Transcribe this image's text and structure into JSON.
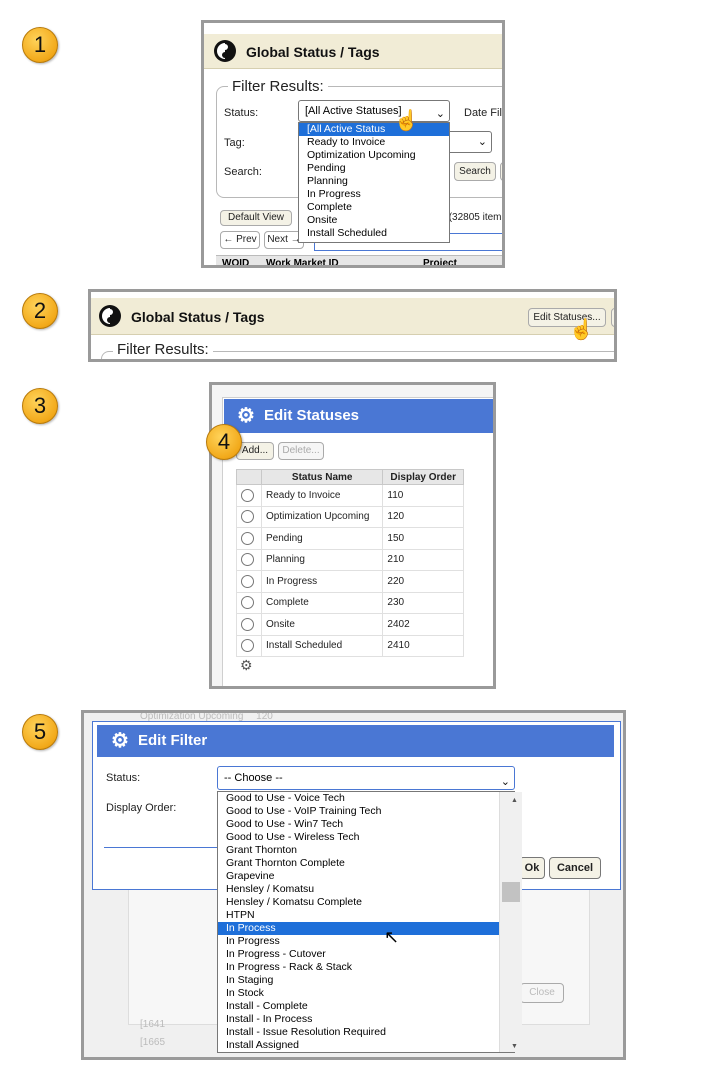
{
  "steps": [
    "1",
    "2",
    "3",
    "4",
    "5"
  ],
  "panel1": {
    "title": "Global Status / Tags",
    "filter_legend": "Filter Results:",
    "status_label": "Status:",
    "status_value": "[All Active Statuses]",
    "date_label": "Date Fil",
    "tag_label": "Tag:",
    "search_label": "Search:",
    "search_button": "Search",
    "default_view": "Default View",
    "items_text": "' (32805 item",
    "prev": "← Prev",
    "next": "Next →",
    "col_woid": "WOID",
    "col_workmarket": "Work Market ID",
    "col_project": "Project",
    "options": [
      "[All Active Status",
      "Ready to Invoice",
      "Optimization Upcoming",
      "Pending",
      "Planning",
      "In Progress",
      "Complete",
      "Onsite",
      "Install Scheduled"
    ]
  },
  "panel2": {
    "title": "Global Status / Tags",
    "edit_statuses": "Edit Statuses...",
    "filter_legend": "Filter Results:"
  },
  "panel3": {
    "title": "Edit Statuses",
    "add": "Add...",
    "delete": "Delete...",
    "col_name": "Status Name",
    "col_order": "Display Order",
    "rows": [
      {
        "name": "Ready to Invoice",
        "order": "110"
      },
      {
        "name": "Optimization Upcoming",
        "order": "120"
      },
      {
        "name": "Pending",
        "order": "150"
      },
      {
        "name": "Planning",
        "order": "210"
      },
      {
        "name": "In Progress",
        "order": "220"
      },
      {
        "name": "Complete",
        "order": "230"
      },
      {
        "name": "Onsite",
        "order": "2402"
      },
      {
        "name": "Install Scheduled",
        "order": "2410"
      }
    ]
  },
  "panel5": {
    "bg_row_name": "Optimization Upcoming",
    "bg_row_order": "120",
    "title": "Edit Filter",
    "status_label": "Status:",
    "status_value": "-- Choose --",
    "display_order_label": "Display Order:",
    "ok": "Ok",
    "cancel": "Cancel",
    "close": "Close",
    "bg_num1": "[1641",
    "bg_num2": "[1665",
    "options": [
      "Good to Use - Voice Tech",
      "Good to Use - VoIP Training Tech",
      "Good to Use - Win7 Tech",
      "Good to Use - Wireless Tech",
      "Grant Thornton",
      "Grant Thornton Complete",
      "Grapevine",
      "Hensley / Komatsu",
      "Hensley / Komatsu Complete",
      "HTPN",
      "In Process",
      "In Progress",
      "In Progress - Cutover",
      "In Progress - Rack & Stack",
      "In Staging",
      "In Stock",
      "Install - Complete",
      "Install - In Process",
      "Install - Issue Resolution Required",
      "Install Assigned"
    ],
    "highlighted": "In Process"
  },
  "colors": {
    "dialog_header": "#4a77d4",
    "highlight": "#1e6fd9",
    "badge": "#f2a91a"
  }
}
